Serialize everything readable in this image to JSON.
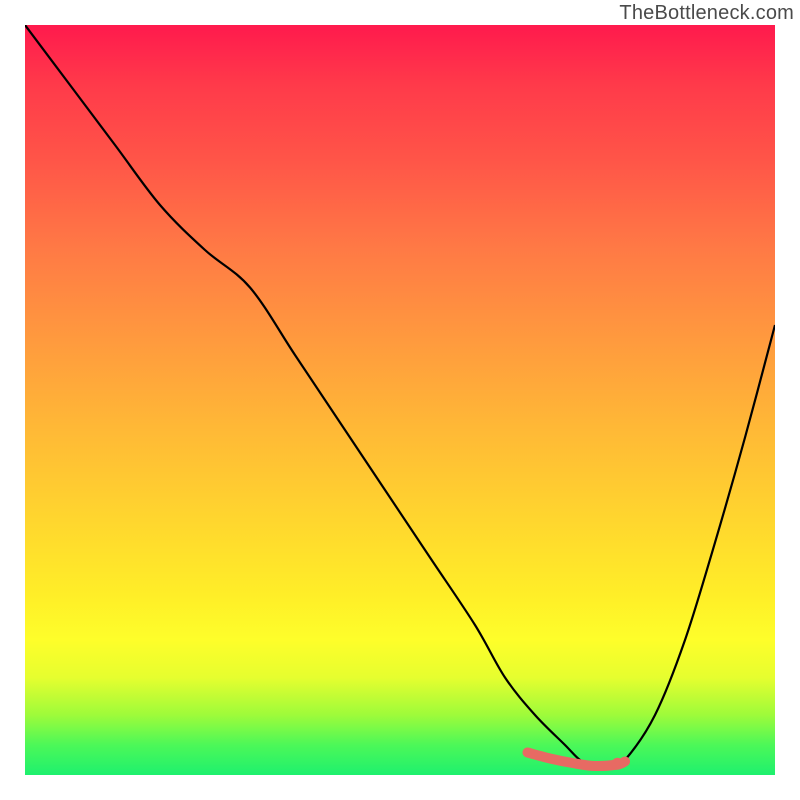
{
  "attribution": "TheBottleneck.com",
  "chart_data": {
    "type": "line",
    "title": "",
    "xlabel": "",
    "ylabel": "",
    "xlim": [
      0,
      100
    ],
    "ylim": [
      0,
      100
    ],
    "grid": false,
    "legend": false,
    "series": [
      {
        "name": "bottleneck-curve",
        "x": [
          0,
          6,
          12,
          18,
          24,
          30,
          36,
          42,
          48,
          54,
          60,
          64,
          68,
          72,
          74,
          76,
          78,
          80,
          84,
          88,
          92,
          96,
          100
        ],
        "values": [
          100,
          92,
          84,
          76,
          70,
          65,
          56,
          47,
          38,
          29,
          20,
          13,
          8,
          4,
          2,
          1,
          1,
          2,
          8,
          18,
          31,
          45,
          60
        ]
      },
      {
        "name": "optimal-range-highlight",
        "x": [
          67,
          70,
          73,
          76,
          79,
          80
        ],
        "values": [
          3,
          2.2,
          1.6,
          1.2,
          1.4,
          1.8
        ]
      }
    ],
    "annotations": [
      {
        "name": "local-min-marker",
        "x": 79,
        "y": 1.5
      }
    ],
    "background_gradient": {
      "top": "#ff1a4d",
      "middle": "#ffd62e",
      "bottom": "#1ef06e"
    }
  }
}
